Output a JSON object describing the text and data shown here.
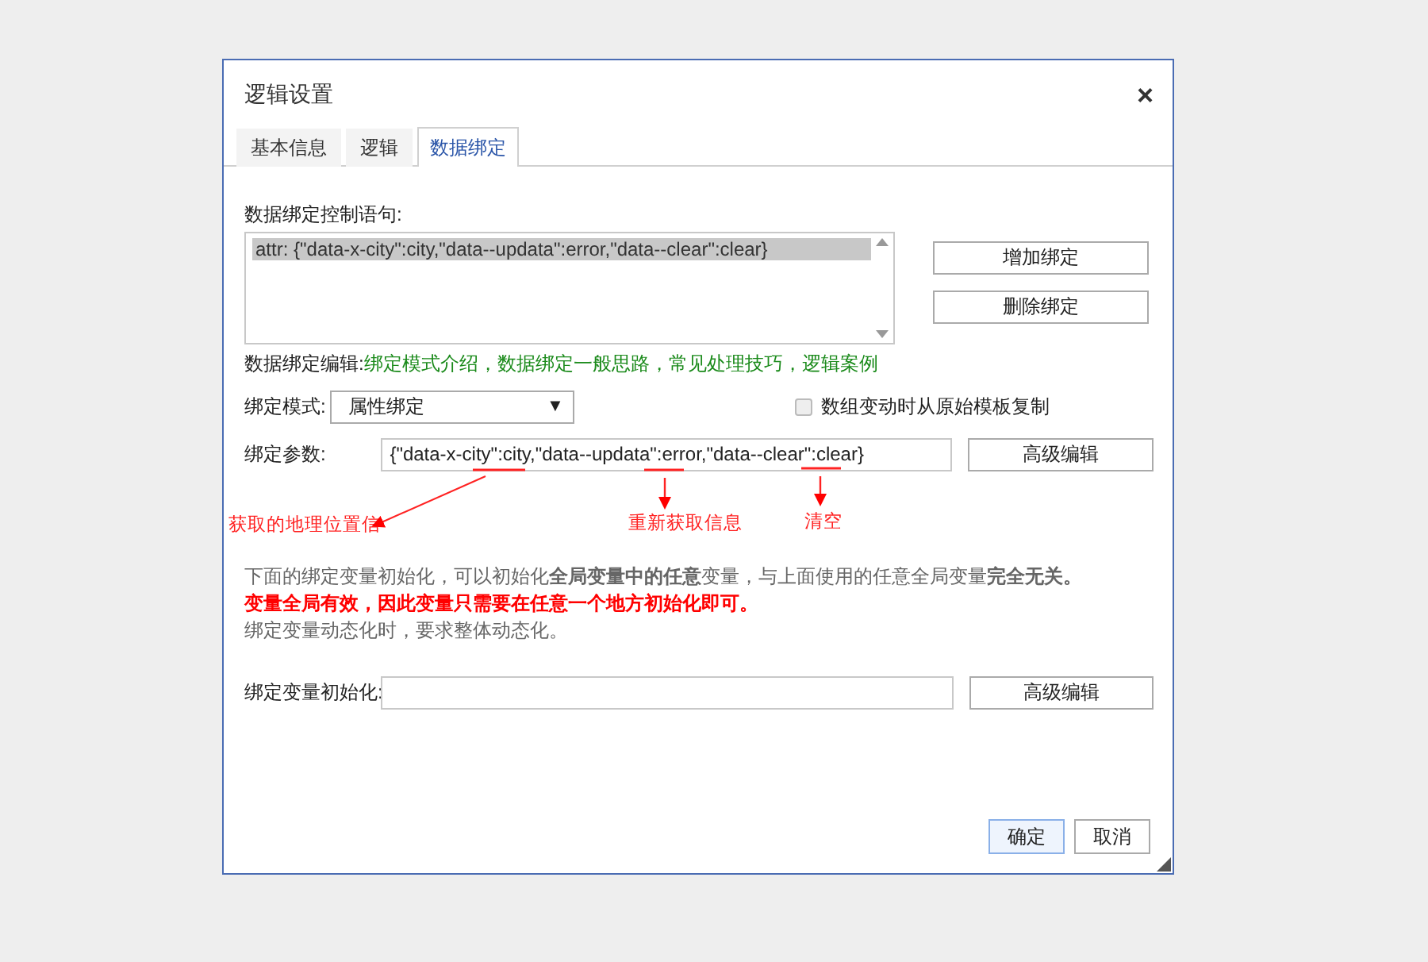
{
  "dialog": {
    "title": "逻辑设置",
    "close": "×"
  },
  "tabs": [
    {
      "label": "基本信息",
      "selected": false
    },
    {
      "label": "逻辑",
      "selected": false
    },
    {
      "label": "数据绑定",
      "selected": true
    }
  ],
  "statements": {
    "label": "数据绑定控制语句:",
    "items": [
      {
        "text": "attr: {\"data-x-city\":city,\"data--updata\":error,\"data--clear\":clear}",
        "selected": true
      }
    ],
    "buttons": [
      "增加绑定",
      "删除绑定"
    ]
  },
  "edit_links": {
    "label": "数据绑定编辑:",
    "separator": "，",
    "links": [
      "绑定模式介绍",
      "数据绑定一般思路",
      "常见处理技巧",
      "逻辑案例"
    ]
  },
  "mode": {
    "label": "绑定模式:",
    "value": "属性绑定",
    "caret": "▼"
  },
  "copy_option": {
    "label": "数组变动时从原始模板复制",
    "checked": false
  },
  "params": {
    "label": "绑定参数:",
    "value": "{\"data-x-city\":city,\"data--updata\":error,\"data--clear\":clear}",
    "button": "高级编辑"
  },
  "annotations": [
    {
      "text": "获取的地理位置信"
    },
    {
      "text": "重新获取信息"
    },
    {
      "text": "清空"
    }
  ],
  "notes": [
    {
      "text": "下面的绑定变量初始化，可以初始化**全局变量中的任意**变量，与上面使用的任意全局变量**完全无关。**",
      "kind": "info"
    },
    {
      "text": "变量全局有效，因此变量只需要在任意一个地方初始化即可。",
      "kind": "warning"
    },
    {
      "text": "绑定变量动态化时，要求整体动态化。",
      "kind": "info"
    }
  ],
  "init": {
    "label": "绑定变量初始化:",
    "button": "高级编辑"
  },
  "footer": [
    {
      "label": "确定",
      "primary": true
    },
    {
      "label": "取消",
      "primary": false
    }
  ]
}
